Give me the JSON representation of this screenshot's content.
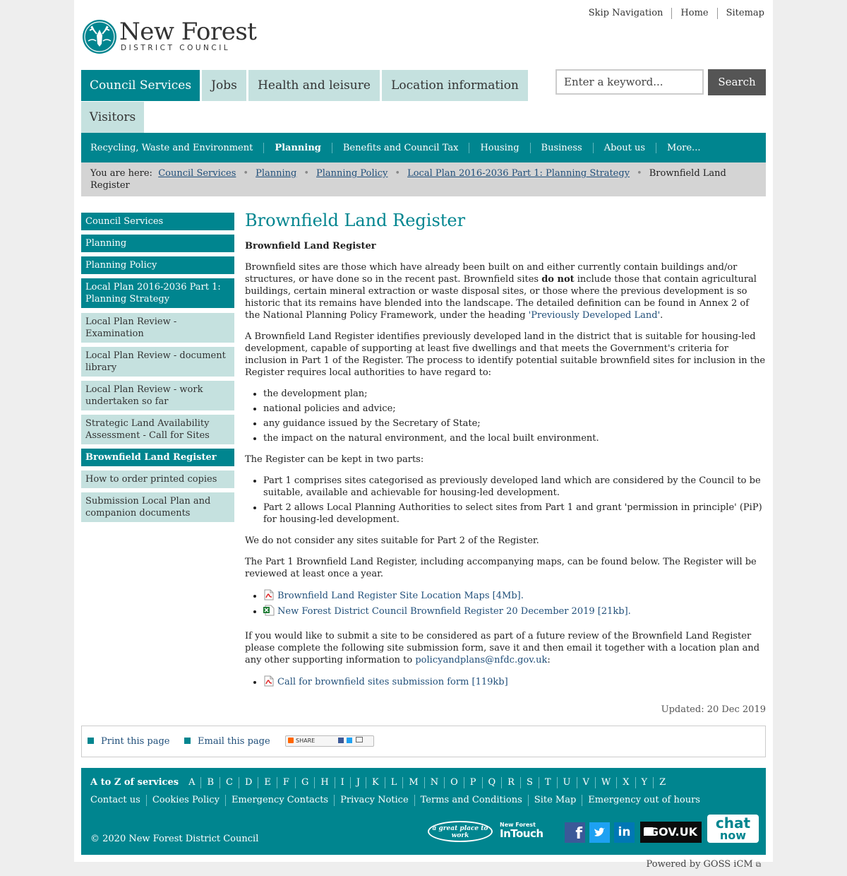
{
  "top_links": [
    "Skip Navigation",
    "Home",
    "Sitemap"
  ],
  "logo": {
    "title": "New Forest",
    "subtitle": "DISTRICT COUNCIL"
  },
  "primary_nav": [
    "Council Services",
    "Jobs",
    "Health and leisure",
    "Location information",
    "Visitors"
  ],
  "search": {
    "placeholder": "Enter a keyword...",
    "button": "Search"
  },
  "secondary_nav": [
    "Recycling, Waste and Environment",
    "Planning",
    "Benefits and Council Tax",
    "Housing",
    "Business",
    "About us",
    "More..."
  ],
  "breadcrumb": {
    "prefix": "You are here:",
    "links": [
      "Council Services",
      "Planning",
      "Planning Policy",
      "Local Plan 2016-2036 Part 1: Planning Strategy"
    ],
    "current": "Brownfield Land Register"
  },
  "side_nav": [
    "Council Services",
    "Planning",
    "Planning Policy",
    "Local Plan 2016-2036 Part 1: Planning Strategy",
    "Local Plan Review - Examination",
    "Local Plan Review - document library",
    "Local Plan Review - work undertaken so far",
    "Strategic Land Availability Assessment - Call for Sites",
    "Brownfield Land Register",
    "How to order printed copies",
    "Submission Local Plan and companion documents"
  ],
  "content": {
    "title": "Brownfield Land Register",
    "subtitle": "Brownfield Land Register",
    "p1_a": "Brownfield sites are those which have already been built on and either currently contain buildings and/or structures, or have done so in the recent past. Brownfield sites ",
    "p1_bold": "do not",
    "p1_b": " include those that contain agricultural buildings, certain mineral extraction or waste disposal sites, or those where the previous development is so historic that its remains have blended into the landscape. The detailed definition can be found in Annex 2 of the National Planning Policy Framework, under the heading ",
    "p1_link": "'Previously Developed Land'",
    "p1_end": ".",
    "p2": "A Brownfield Land Register identifies previously developed land in the district that is suitable for housing-led development, capable of supporting at least five dwellings and that meets the Government's criteria for inclusion in Part 1 of the Register. The process to identify potential suitable brownfield sites for inclusion in the Register requires local authorities to have regard to:",
    "list1": [
      "the development plan;",
      "national policies and advice;",
      "any guidance issued by the Secretary of State;",
      "the impact on the natural environment, and the local built environment."
    ],
    "p3": "The Register can be kept in two parts:",
    "list2": [
      "Part 1 comprises sites categorised as previously developed land which are considered by the Council to be suitable, available and achievable for housing-led development.",
      "Part 2 allows Local Planning Authorities to select sites from Part 1 and grant 'permission in principle' (PiP) for housing-led development."
    ],
    "p4": "We do not consider any sites suitable for Part 2 of the Register.",
    "p5": "The Part 1 Brownfield Land Register, including accompanying maps, can be found below. The Register will be reviewed at least once a year.",
    "downloads": [
      {
        "icon": "pdf-icon",
        "label": "Brownfield Land Register Site Location Maps [4Mb]",
        "end": "."
      },
      {
        "icon": "excel-icon",
        "label": "New Forest District Council Brownfield Register 20 December 2019 [21kb]",
        "end": "."
      }
    ],
    "p6_a": "If you would like to submit a site to be considered as part of a future review of the Brownfield Land Register please complete the following site submission form, save it and then email it together with a location plan and any other supporting information to ",
    "p6_link": "policyandplans@nfdc.gov.uk",
    "p6_end": ":",
    "form_link": {
      "icon": "pdf-icon",
      "label": "Call for brownfield sites submission form [119kb]"
    }
  },
  "updated": "Updated: 20 Dec 2019",
  "tools": {
    "print": "Print this page",
    "email": "Email this page",
    "share": "SHARE"
  },
  "footer": {
    "atoz_label": "A to Z of services",
    "letters": [
      "A",
      "B",
      "C",
      "D",
      "E",
      "F",
      "G",
      "H",
      "I",
      "J",
      "K",
      "L",
      "M",
      "N",
      "O",
      "P",
      "Q",
      "R",
      "S",
      "T",
      "U",
      "V",
      "W",
      "X",
      "Y",
      "Z"
    ],
    "links": [
      "Contact us",
      "Cookies Policy",
      "Emergency Contacts",
      "Privacy Notice",
      "Terms and Conditions",
      "Site Map",
      "Emergency out of hours"
    ],
    "copyright": "© 2020 New Forest District Council",
    "badges": {
      "great_place": "a great place to work",
      "intouch_top": "New Forest",
      "intouch_bottom": "InTouch",
      "govuk": "GOV.UK",
      "chat_top": "chat",
      "chat_bottom": "now"
    }
  },
  "powered_by": "Powered by GOSS iCM",
  "colors": {
    "teal": "#00858f",
    "light_teal": "#c5e1df",
    "link": "#1f4e79"
  }
}
